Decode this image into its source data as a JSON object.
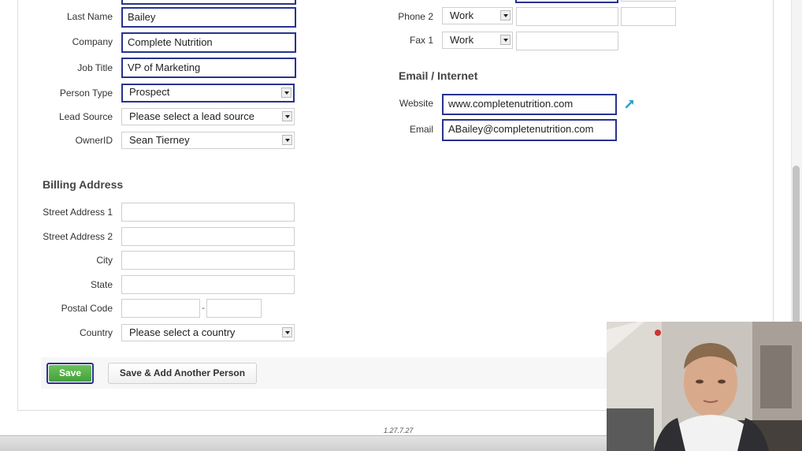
{
  "person": {
    "last_name": {
      "label": "Last Name",
      "value": "Bailey"
    },
    "company": {
      "label": "Company",
      "value": "Complete Nutrition"
    },
    "job_title": {
      "label": "Job Title",
      "value": "VP of Marketing"
    },
    "person_type": {
      "label": "Person Type",
      "value": "Prospect"
    },
    "lead_source": {
      "label": "Lead Source",
      "value": "Please select a lead source"
    },
    "owner": {
      "label": "OwnerID",
      "value": "Sean Tierney"
    }
  },
  "phones": {
    "phone2": {
      "label": "Phone 2",
      "type": "Work"
    },
    "fax1": {
      "label": "Fax 1",
      "type": "Work"
    }
  },
  "email_internet": {
    "title": "Email / Internet",
    "website": {
      "label": "Website",
      "value": "www.completenutrition.com"
    },
    "email": {
      "label": "Email",
      "value": "ABailey@completenutrition.com"
    }
  },
  "billing": {
    "title": "Billing Address",
    "street1": {
      "label": "Street Address 1",
      "value": ""
    },
    "street2": {
      "label": "Street Address 2",
      "value": ""
    },
    "city": {
      "label": "City",
      "value": ""
    },
    "state": {
      "label": "State",
      "value": ""
    },
    "postal": {
      "label": "Postal Code",
      "separator": "-"
    },
    "country": {
      "label": "Country",
      "value": "Please select a country"
    }
  },
  "actions": {
    "save": "Save",
    "save_add": "Save & Add Another Person"
  },
  "footer": {
    "version": "1.27.7.27"
  },
  "colors": {
    "focus_border": "#28338e",
    "save_green": "#4fae42",
    "website_arrow": "#2aa5c8"
  }
}
